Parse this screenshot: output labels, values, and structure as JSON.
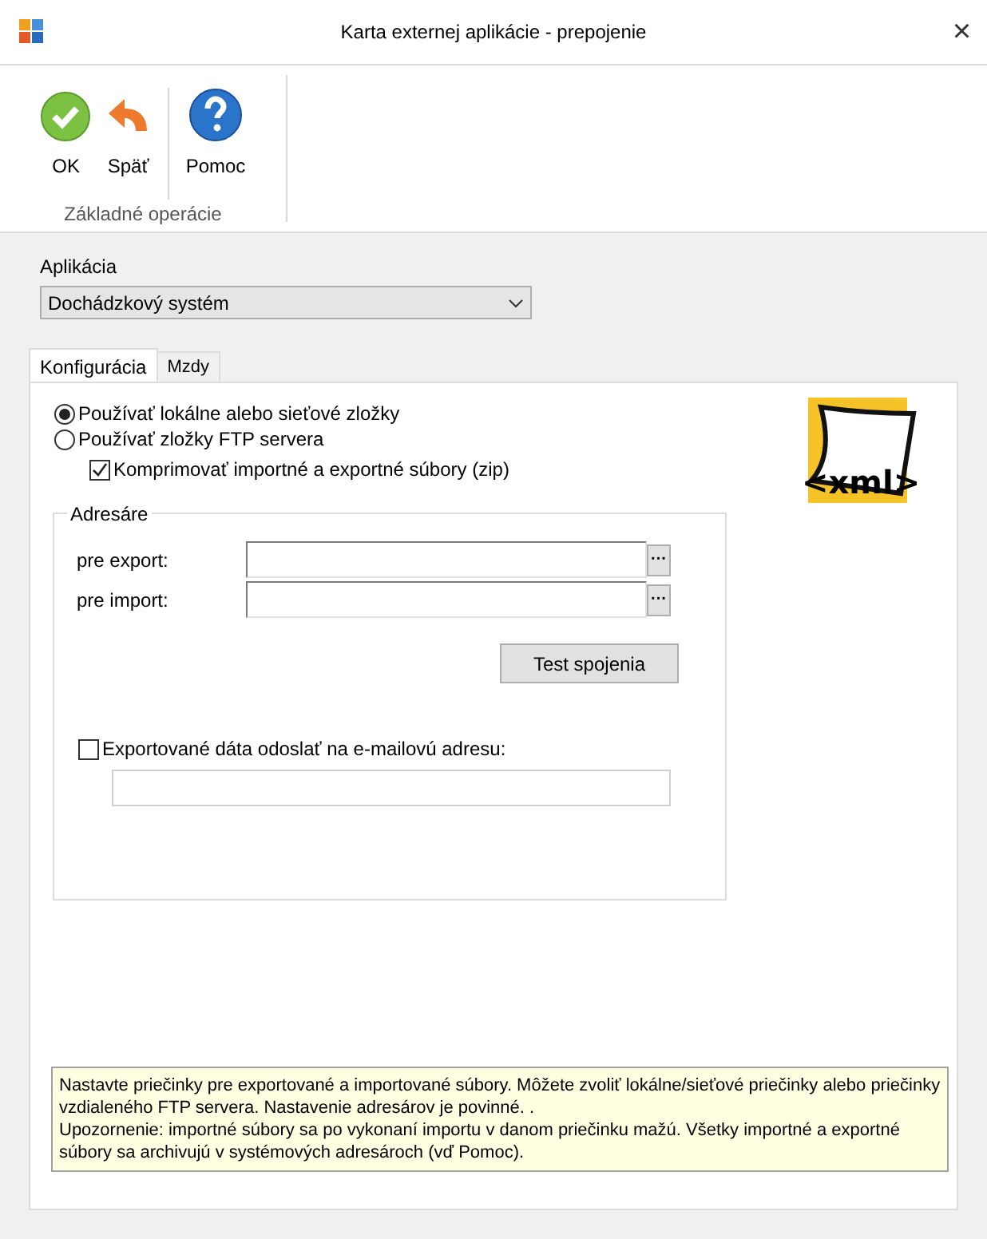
{
  "window": {
    "title": "Karta externej aplikácie - prepojenie",
    "close": "×"
  },
  "toolbar": {
    "buttons": [
      {
        "kind": "ok",
        "label": "OK"
      },
      {
        "kind": "back",
        "label": "Späť"
      },
      {
        "kind": "help",
        "label": "Pomoc"
      }
    ],
    "group_label": "Základné operácie"
  },
  "application": {
    "label": "Aplikácia",
    "value": "Dochádzkový systém"
  },
  "logo": {
    "text": "<xml>"
  },
  "tabs": [
    {
      "label": "Konfigurácia",
      "selected": true
    },
    {
      "label": "Mzdy",
      "selected": false
    }
  ],
  "source": [
    {
      "label": "Používať lokálne alebo sieťové zložky",
      "selected": true
    },
    {
      "label": "Používať zložky FTP servera",
      "selected": false
    }
  ],
  "compress": {
    "label": "Komprimovať importné a exportné súbory (zip)",
    "checked": true
  },
  "directories": {
    "title": "Adresáre",
    "fields": [
      {
        "label": "pre export:",
        "button": "···"
      },
      {
        "label": "pre import:",
        "button": "···"
      }
    ],
    "test_button": "Test spojenia"
  },
  "email": {
    "label": "Exportované dáta odoslať na e-mailovú adresu:",
    "checked": false
  },
  "info": [
    "Nastavte priečinky pre exportované a importované súbory. Môžete zvoliť lokálne/sieťové priečinky alebo priečinky vzdialeného FTP servera. Nastavenie adresárov je povinné. .",
    "Upozornenie: importné súbory sa po vykonaní importu v danom priečinku mažú. Všetky importné a exportné súbory sa archivujú v systémových adresároch (vď Pomoc)."
  ]
}
